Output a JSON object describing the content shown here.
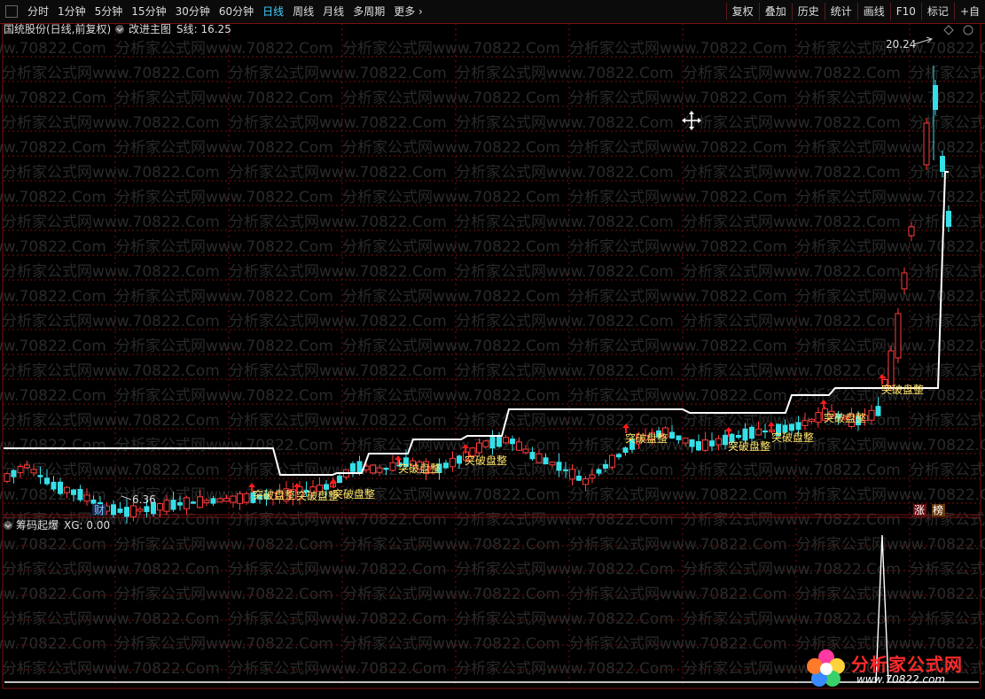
{
  "toolbar": {
    "periods": [
      "分时",
      "1分钟",
      "5分钟",
      "15分钟",
      "30分钟",
      "60分钟",
      "日线",
      "周线",
      "月线",
      "多周期",
      "更多"
    ],
    "active_period": "日线",
    "right_buttons": [
      "复权",
      "叠加",
      "历史",
      "统计",
      "画线",
      "F10",
      "标记",
      "+自"
    ]
  },
  "main_panel": {
    "stock_name": "国统股份(日线,前复权)",
    "indicator_name": "改进主图",
    "indicator_value": "S线: 16.25",
    "max_label": "20.24",
    "min_label": "6.36",
    "badge_finance": "财",
    "badge_up": "涨",
    "badge_rank": "榜",
    "signal_label": "突破盘整"
  },
  "sub_panel": {
    "indicator_name": "筹码起爆",
    "indicator_value": "XG: 0.00"
  },
  "watermark": "分析家公式网www.70822.Com",
  "logo": {
    "name": "分析家公式网",
    "url": "www.70822.com"
  },
  "colors": {
    "up": "#ff3b3b",
    "down": "#35dfe8",
    "grid": "#7a1010",
    "sline": "#ffffff",
    "signal": "#ffe46a",
    "arrow": "#ff1a1a"
  },
  "chart_data": {
    "type": "candlestick",
    "price_range": [
      6.36,
      20.24
    ],
    "s_line_current": 16.25,
    "sub_indicator_current": 0.0
  }
}
